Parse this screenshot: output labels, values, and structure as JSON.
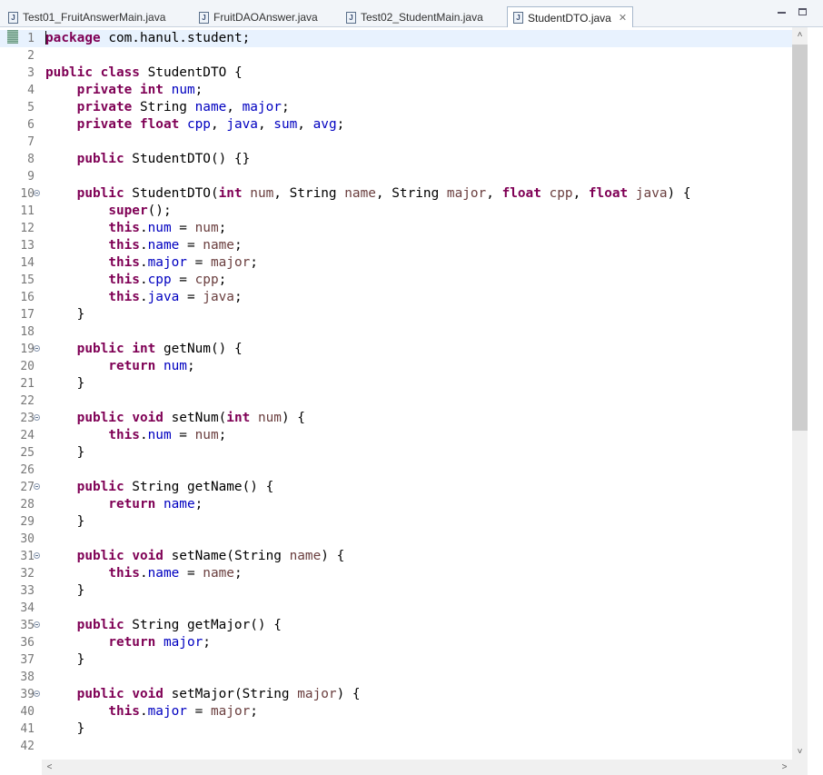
{
  "tabs": [
    {
      "label": "Test01_FruitAnswerMain.java",
      "active": false
    },
    {
      "label": "FruitDAOAnswer.java",
      "active": false
    },
    {
      "label": "Test02_StudentMain.java",
      "active": false
    },
    {
      "label": "StudentDTO.java",
      "active": true
    }
  ],
  "tab_close_symbol": "✕",
  "scroll": {
    "up": "˄",
    "down": "˅",
    "left": "˂",
    "right": "˃",
    "vertical_position": 0
  },
  "editor": {
    "lines": [
      {
        "n": "1",
        "fold": false,
        "tokens": [
          [
            "kw",
            "package"
          ],
          [
            "t",
            " com.hanul.student;"
          ]
        ]
      },
      {
        "n": "2",
        "fold": false,
        "tokens": []
      },
      {
        "n": "3",
        "fold": false,
        "tokens": [
          [
            "kw",
            "public"
          ],
          [
            "t",
            " "
          ],
          [
            "kw",
            "class"
          ],
          [
            "t",
            " StudentDTO {"
          ]
        ]
      },
      {
        "n": "4",
        "fold": false,
        "tokens": [
          [
            "t",
            "    "
          ],
          [
            "kw",
            "private"
          ],
          [
            "t",
            " "
          ],
          [
            "kw",
            "int"
          ],
          [
            "t",
            " "
          ],
          [
            "fld",
            "num"
          ],
          [
            "t",
            ";"
          ]
        ]
      },
      {
        "n": "5",
        "fold": false,
        "tokens": [
          [
            "t",
            "    "
          ],
          [
            "kw",
            "private"
          ],
          [
            "t",
            " String "
          ],
          [
            "fld",
            "name"
          ],
          [
            "t",
            ", "
          ],
          [
            "fld",
            "major"
          ],
          [
            "t",
            ";"
          ]
        ]
      },
      {
        "n": "6",
        "fold": false,
        "tokens": [
          [
            "t",
            "    "
          ],
          [
            "kw",
            "private"
          ],
          [
            "t",
            " "
          ],
          [
            "kw",
            "float"
          ],
          [
            "t",
            " "
          ],
          [
            "fld",
            "cpp"
          ],
          [
            "t",
            ", "
          ],
          [
            "fld",
            "java"
          ],
          [
            "t",
            ", "
          ],
          [
            "fld",
            "sum"
          ],
          [
            "t",
            ", "
          ],
          [
            "fld",
            "avg"
          ],
          [
            "t",
            ";"
          ]
        ]
      },
      {
        "n": "7",
        "fold": false,
        "tokens": []
      },
      {
        "n": "8",
        "fold": false,
        "tokens": [
          [
            "t",
            "    "
          ],
          [
            "kw",
            "public"
          ],
          [
            "t",
            " StudentDTO() {}"
          ]
        ]
      },
      {
        "n": "9",
        "fold": false,
        "tokens": []
      },
      {
        "n": "10",
        "fold": true,
        "tokens": [
          [
            "t",
            "    "
          ],
          [
            "kw",
            "public"
          ],
          [
            "t",
            " StudentDTO("
          ],
          [
            "kw",
            "int"
          ],
          [
            "t",
            " "
          ],
          [
            "loc",
            "num"
          ],
          [
            "t",
            ", String "
          ],
          [
            "loc",
            "name"
          ],
          [
            "t",
            ", String "
          ],
          [
            "loc",
            "major"
          ],
          [
            "t",
            ", "
          ],
          [
            "kw",
            "float"
          ],
          [
            "t",
            " "
          ],
          [
            "loc",
            "cpp"
          ],
          [
            "t",
            ", "
          ],
          [
            "kw",
            "float"
          ],
          [
            "t",
            " "
          ],
          [
            "loc",
            "java"
          ],
          [
            "t",
            ") {"
          ]
        ]
      },
      {
        "n": "11",
        "fold": false,
        "tokens": [
          [
            "t",
            "        "
          ],
          [
            "kw",
            "super"
          ],
          [
            "t",
            "();"
          ]
        ]
      },
      {
        "n": "12",
        "fold": false,
        "tokens": [
          [
            "t",
            "        "
          ],
          [
            "kw",
            "this"
          ],
          [
            "t",
            "."
          ],
          [
            "fld",
            "num"
          ],
          [
            "t",
            " = "
          ],
          [
            "loc",
            "num"
          ],
          [
            "t",
            ";"
          ]
        ]
      },
      {
        "n": "13",
        "fold": false,
        "tokens": [
          [
            "t",
            "        "
          ],
          [
            "kw",
            "this"
          ],
          [
            "t",
            "."
          ],
          [
            "fld",
            "name"
          ],
          [
            "t",
            " = "
          ],
          [
            "loc",
            "name"
          ],
          [
            "t",
            ";"
          ]
        ]
      },
      {
        "n": "14",
        "fold": false,
        "tokens": [
          [
            "t",
            "        "
          ],
          [
            "kw",
            "this"
          ],
          [
            "t",
            "."
          ],
          [
            "fld",
            "major"
          ],
          [
            "t",
            " = "
          ],
          [
            "loc",
            "major"
          ],
          [
            "t",
            ";"
          ]
        ]
      },
      {
        "n": "15",
        "fold": false,
        "tokens": [
          [
            "t",
            "        "
          ],
          [
            "kw",
            "this"
          ],
          [
            "t",
            "."
          ],
          [
            "fld",
            "cpp"
          ],
          [
            "t",
            " = "
          ],
          [
            "loc",
            "cpp"
          ],
          [
            "t",
            ";"
          ]
        ]
      },
      {
        "n": "16",
        "fold": false,
        "tokens": [
          [
            "t",
            "        "
          ],
          [
            "kw",
            "this"
          ],
          [
            "t",
            "."
          ],
          [
            "fld",
            "java"
          ],
          [
            "t",
            " = "
          ],
          [
            "loc",
            "java"
          ],
          [
            "t",
            ";"
          ]
        ]
      },
      {
        "n": "17",
        "fold": false,
        "tokens": [
          [
            "t",
            "    }"
          ]
        ]
      },
      {
        "n": "18",
        "fold": false,
        "tokens": []
      },
      {
        "n": "19",
        "fold": true,
        "tokens": [
          [
            "t",
            "    "
          ],
          [
            "kw",
            "public"
          ],
          [
            "t",
            " "
          ],
          [
            "kw",
            "int"
          ],
          [
            "t",
            " getNum() {"
          ]
        ]
      },
      {
        "n": "20",
        "fold": false,
        "tokens": [
          [
            "t",
            "        "
          ],
          [
            "kw",
            "return"
          ],
          [
            "t",
            " "
          ],
          [
            "fld",
            "num"
          ],
          [
            "t",
            ";"
          ]
        ]
      },
      {
        "n": "21",
        "fold": false,
        "tokens": [
          [
            "t",
            "    }"
          ]
        ]
      },
      {
        "n": "22",
        "fold": false,
        "tokens": []
      },
      {
        "n": "23",
        "fold": true,
        "tokens": [
          [
            "t",
            "    "
          ],
          [
            "kw",
            "public"
          ],
          [
            "t",
            " "
          ],
          [
            "kw",
            "void"
          ],
          [
            "t",
            " setNum("
          ],
          [
            "kw",
            "int"
          ],
          [
            "t",
            " "
          ],
          [
            "loc",
            "num"
          ],
          [
            "t",
            ") {"
          ]
        ]
      },
      {
        "n": "24",
        "fold": false,
        "tokens": [
          [
            "t",
            "        "
          ],
          [
            "kw",
            "this"
          ],
          [
            "t",
            "."
          ],
          [
            "fld",
            "num"
          ],
          [
            "t",
            " = "
          ],
          [
            "loc",
            "num"
          ],
          [
            "t",
            ";"
          ]
        ]
      },
      {
        "n": "25",
        "fold": false,
        "tokens": [
          [
            "t",
            "    }"
          ]
        ]
      },
      {
        "n": "26",
        "fold": false,
        "tokens": []
      },
      {
        "n": "27",
        "fold": true,
        "tokens": [
          [
            "t",
            "    "
          ],
          [
            "kw",
            "public"
          ],
          [
            "t",
            " String getName() {"
          ]
        ]
      },
      {
        "n": "28",
        "fold": false,
        "tokens": [
          [
            "t",
            "        "
          ],
          [
            "kw",
            "return"
          ],
          [
            "t",
            " "
          ],
          [
            "fld",
            "name"
          ],
          [
            "t",
            ";"
          ]
        ]
      },
      {
        "n": "29",
        "fold": false,
        "tokens": [
          [
            "t",
            "    }"
          ]
        ]
      },
      {
        "n": "30",
        "fold": false,
        "tokens": []
      },
      {
        "n": "31",
        "fold": true,
        "tokens": [
          [
            "t",
            "    "
          ],
          [
            "kw",
            "public"
          ],
          [
            "t",
            " "
          ],
          [
            "kw",
            "void"
          ],
          [
            "t",
            " setName(String "
          ],
          [
            "loc",
            "name"
          ],
          [
            "t",
            ") {"
          ]
        ]
      },
      {
        "n": "32",
        "fold": false,
        "tokens": [
          [
            "t",
            "        "
          ],
          [
            "kw",
            "this"
          ],
          [
            "t",
            "."
          ],
          [
            "fld",
            "name"
          ],
          [
            "t",
            " = "
          ],
          [
            "loc",
            "name"
          ],
          [
            "t",
            ";"
          ]
        ]
      },
      {
        "n": "33",
        "fold": false,
        "tokens": [
          [
            "t",
            "    }"
          ]
        ]
      },
      {
        "n": "34",
        "fold": false,
        "tokens": []
      },
      {
        "n": "35",
        "fold": true,
        "tokens": [
          [
            "t",
            "    "
          ],
          [
            "kw",
            "public"
          ],
          [
            "t",
            " String getMajor() {"
          ]
        ]
      },
      {
        "n": "36",
        "fold": false,
        "tokens": [
          [
            "t",
            "        "
          ],
          [
            "kw",
            "return"
          ],
          [
            "t",
            " "
          ],
          [
            "fld",
            "major"
          ],
          [
            "t",
            ";"
          ]
        ]
      },
      {
        "n": "37",
        "fold": false,
        "tokens": [
          [
            "t",
            "    }"
          ]
        ]
      },
      {
        "n": "38",
        "fold": false,
        "tokens": []
      },
      {
        "n": "39",
        "fold": true,
        "tokens": [
          [
            "t",
            "    "
          ],
          [
            "kw",
            "public"
          ],
          [
            "t",
            " "
          ],
          [
            "kw",
            "void"
          ],
          [
            "t",
            " setMajor(String "
          ],
          [
            "loc",
            "major"
          ],
          [
            "t",
            ") {"
          ]
        ]
      },
      {
        "n": "40",
        "fold": false,
        "tokens": [
          [
            "t",
            "        "
          ],
          [
            "kw",
            "this"
          ],
          [
            "t",
            "."
          ],
          [
            "fld",
            "major"
          ],
          [
            "t",
            " = "
          ],
          [
            "loc",
            "major"
          ],
          [
            "t",
            ";"
          ]
        ]
      },
      {
        "n": "41",
        "fold": false,
        "tokens": [
          [
            "t",
            "    }"
          ]
        ]
      },
      {
        "n": "42",
        "fold": false,
        "tokens": []
      }
    ]
  }
}
